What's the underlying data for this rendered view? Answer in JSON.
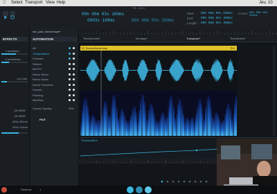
{
  "menubar": {
    "items": [
      "Select",
      "Transport",
      "View",
      "Help"
    ],
    "title": "TS - 2.1.3",
    "right": [
      "Jeu. 10"
    ]
  },
  "transport": {
    "time_primary": "00h 00m 03s 160ms",
    "time_secondary": "0003s 160ms",
    "time_tertiary": "00h 00m 03s 160ms",
    "start_label": "Start:",
    "start_value": "00h 00m 00s 000ms",
    "end_label": "End:",
    "end_value": "00h 00m 05s 306ms",
    "length_label": "Length:",
    "length_value": "00h 00m 05s 306ms",
    "cursor_label": "Cursor:",
    "cursor_value": "00h 00m 05s 318ms"
  },
  "tabs": [
    "TimeSpectral*",
    "Montage*",
    "Transpose*",
    "TimeStretch*"
  ],
  "project_name": "son_jazz_harmonique*",
  "left_panel": {
    "title": "EFFECTS",
    "rows": [
      "1 semitone",
      "0 semitones",
      "1x1.2ms",
      "120 BPM",
      "120 BPM",
      "000s 000ms",
      "000s 313ms"
    ]
  },
  "automation": {
    "title": "AUTOMATION",
    "items": [
      "All:",
      "Transposition:",
      "Formant:",
      "Stretch:",
      "Mix/FX:",
      "Remix Sinus:",
      "Remix Noise:",
      "Remix Transient:",
      "Volume:",
      "Panning:",
      "Mid/Side:"
    ],
    "curve_label": "Curves Opacity:",
    "curve_value": "30%",
    "file_label": "FILE"
  },
  "track": {
    "name": "01 TechnoNoble.wav",
    "right_label": "R:0"
  },
  "lane_label": "Transposition",
  "footer": {
    "status": "Rainbow",
    "zoom": "1"
  },
  "colors": {
    "accent": "#39b8e0",
    "track_header": "#e0c12a",
    "background": "#15181c"
  }
}
